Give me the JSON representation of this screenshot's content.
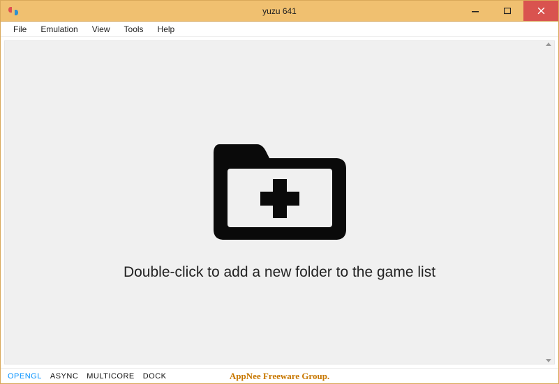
{
  "titlebar": {
    "title": "yuzu 641"
  },
  "menubar": {
    "items": [
      "File",
      "Emulation",
      "View",
      "Tools",
      "Help"
    ]
  },
  "content": {
    "hint_text": "Double-click to add a new folder to the game list"
  },
  "statusbar": {
    "items": [
      {
        "label": "OPENGL",
        "highlight": true
      },
      {
        "label": "ASYNC",
        "highlight": false
      },
      {
        "label": "MULTICORE",
        "highlight": false
      },
      {
        "label": "DOCK",
        "highlight": false
      }
    ],
    "watermark": "AppNee Freeware Group."
  }
}
